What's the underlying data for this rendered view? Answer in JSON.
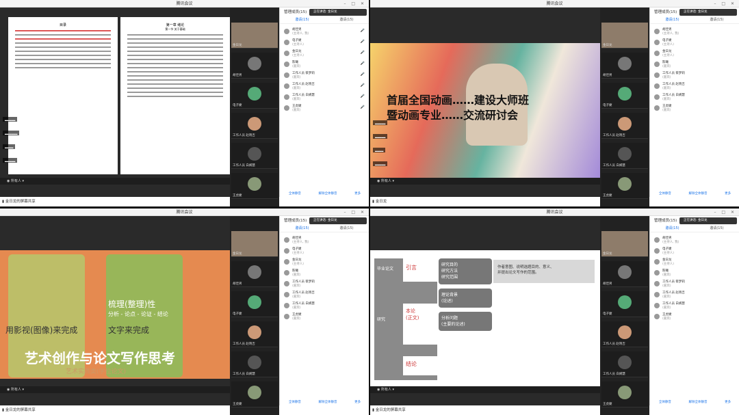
{
  "window_title": "腾讯会议",
  "tip": "正在讲话: 金日龙",
  "panel": {
    "header": "管理成员(15)",
    "tab_members": "邀请(15)",
    "tab_all": "邀请(15)",
    "footer": [
      "全体静音",
      "解除全体静音",
      "更多"
    ]
  },
  "toolbar_label": "所有人",
  "status_q0": "金日龙的屏幕共享",
  "status_q1": "金日龙",
  "status_q2": "金日龙的屏幕共享",
  "status_q3": "金日龙的屏幕共享",
  "participants": [
    "胡佳男",
    "电子婕",
    "金日龙",
    "陈曦",
    "工作人员 蔡梦莉",
    "工作人员 赵晓吉",
    "工作人员 白嫣慧",
    "王虎婕"
  ],
  "sub": [
    "(主持人, 我)",
    "(主持人)",
    "(主持人)",
    "(嘉宾)",
    "(嘉宾)",
    "(嘉宾)",
    "(嘉宾)",
    "(嘉宾)"
  ],
  "tiles": [
    "金日龙",
    "胡佳男",
    "电子婕",
    "工作人员 赵晓吉",
    "工作人员 白嫣慧",
    "王虎婕"
  ],
  "q0": {
    "toc": "目录",
    "chapter": "第一章 绪论",
    "section": "第一节 关于基础"
  },
  "q1": {
    "slide_line1": "首届全国动画……建设大师班",
    "slide_line2": "暨动画专业……交流研讨会"
  },
  "q2": {
    "l1": "梳理(整理)性",
    "l2": "分析 - 论点 - 论证 - 结论",
    "l3": "文字来完成",
    "l4": "用影视(图像)来完成",
    "big": "艺术创作与论文写作思考",
    "sub": "艺术实践类(学位论文)"
  },
  "q3": {
    "b1": "引言",
    "b2": "研究目的\n研究方法\n研究范围",
    "t1": "作者意图、说明选题目的、意义、\n并提出论文写作的范围。",
    "b3": "理论背景\n(论述)",
    "b4": "本论\n(正文)",
    "b5": "分析问题\n(主要的论述)",
    "b6": "结论",
    "lbl": "毕业论文",
    "lbl2": "研究"
  }
}
